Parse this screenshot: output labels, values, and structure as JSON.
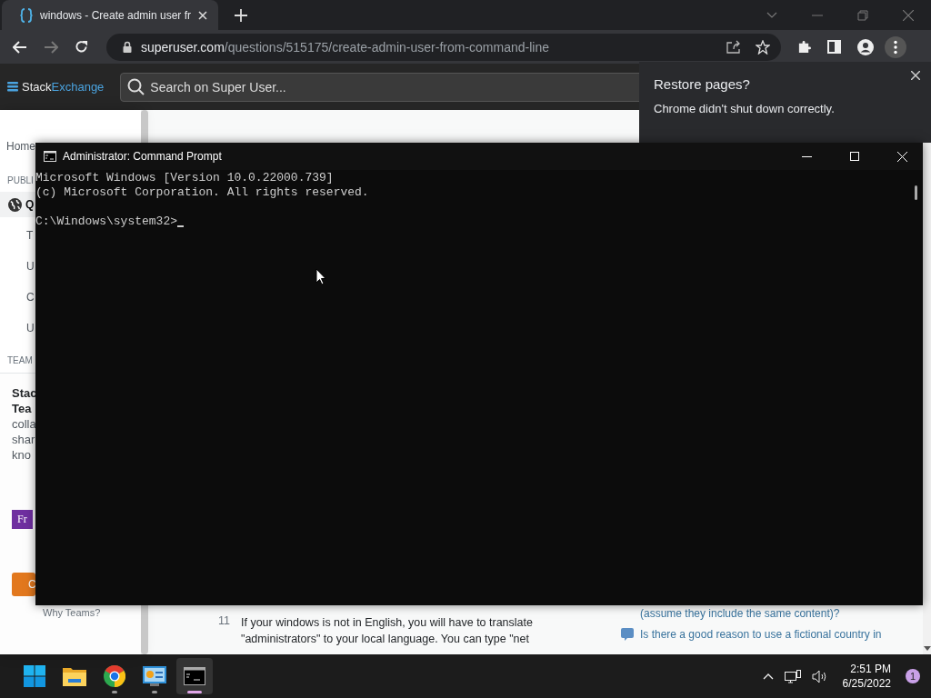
{
  "browser": {
    "tab_title": "windows - Create admin user fr",
    "url_host": "superuser.com",
    "url_path": "/questions/515175/create-admin-user-from-command-line"
  },
  "site_header": {
    "logo_first": "Stack",
    "logo_second": "Exchange",
    "search": {
      "placeholder": "Search on Super User..."
    }
  },
  "restore_popup": {
    "title": "Restore pages?",
    "message": "Chrome didn't shut down correctly."
  },
  "sidebar": {
    "home": "Home",
    "public_heading": "PUBLI",
    "items": [
      {
        "label": "Q",
        "selected": true
      },
      {
        "label": "T",
        "selected": false
      },
      {
        "label": "U",
        "selected": false
      },
      {
        "label": "C",
        "selected": false
      },
      {
        "label": "U",
        "selected": false
      }
    ],
    "teams_heading": "TEAM",
    "teams_title_lines": [
      "Stac",
      "Tea"
    ],
    "teams_text_lines": [
      "colla",
      "shar",
      "kno"
    ],
    "badge": "Fr",
    "button": "C",
    "why_teams": "Why Teams?"
  },
  "answer": {
    "votes": "11",
    "lines": [
      "If your windows is not in English, you will have to translate",
      "\"administrators\" to your local language. You can type \"net"
    ]
  },
  "related": {
    "continued_text": "(assume they include the same content)?",
    "questions": [
      "Is there a good reason to use a fictional country in"
    ]
  },
  "cmd": {
    "title": "Administrator: Command Prompt",
    "output_lines": [
      "Microsoft Windows [Version 10.0.22000.739]",
      "(c) Microsoft Corporation. All rights reserved."
    ],
    "prompt": "C:\\Windows\\system32>"
  },
  "taskbar": {
    "apps": [
      {
        "kind": "start",
        "running": false,
        "selected": false
      },
      {
        "kind": "explorer",
        "running": false,
        "selected": false
      },
      {
        "kind": "chrome",
        "running": true,
        "selected": false
      },
      {
        "kind": "control",
        "running": true,
        "selected": false
      },
      {
        "kind": "terminal",
        "running": true,
        "selected": true
      }
    ],
    "time": "2:51 PM",
    "date": "6/25/2022",
    "notifications": "1"
  }
}
